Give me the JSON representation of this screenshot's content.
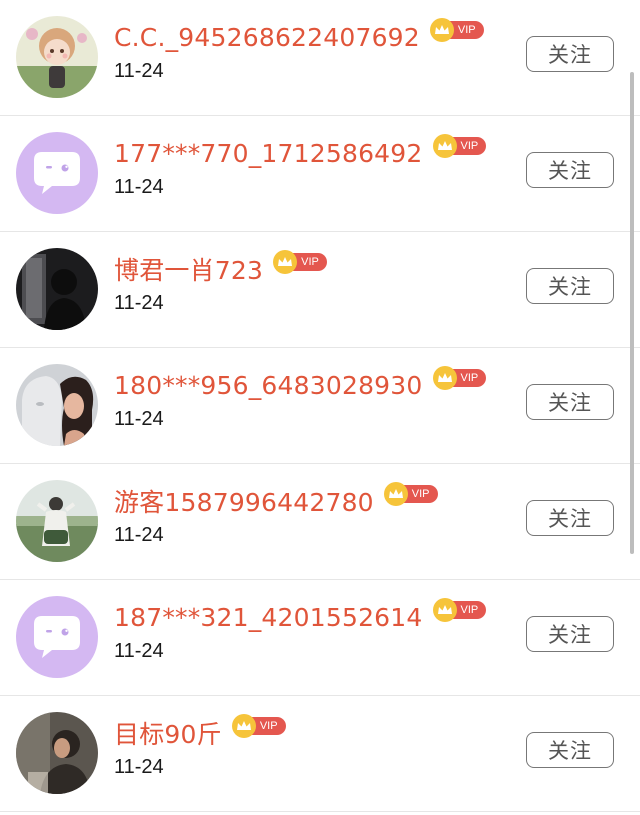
{
  "users": [
    {
      "name": "C.C._945268622407692",
      "vip_label": "VIP",
      "date": "11-24",
      "follow_label": "关注",
      "avatar": "girl-illustration-avatar"
    },
    {
      "name": "177***770_1712586492",
      "vip_label": "VIP",
      "date": "11-24",
      "follow_label": "关注",
      "avatar": "default-chat-bubble-avatar"
    },
    {
      "name": "博君一肖723",
      "vip_label": "VIP",
      "date": "11-24",
      "follow_label": "关注",
      "avatar": "dark-silhouette-avatar"
    },
    {
      "name": "180***956_6483028930",
      "vip_label": "VIP",
      "date": "11-24",
      "follow_label": "关注",
      "avatar": "statue-portrait-avatar"
    },
    {
      "name": "游客1587996442780",
      "vip_label": "VIP",
      "date": "11-24",
      "follow_label": "关注",
      "avatar": "field-photo-avatar"
    },
    {
      "name": "187***321_4201552614",
      "vip_label": "VIP",
      "date": "11-24",
      "follow_label": "关注",
      "avatar": "default-chat-bubble-avatar"
    },
    {
      "name": "目标90斤",
      "vip_label": "VIP",
      "date": "11-24",
      "follow_label": "关注",
      "avatar": "dim-portrait-avatar"
    }
  ],
  "colors": {
    "name": "#e0553a",
    "vip_tag": "#e4574f",
    "crown": "#f6c43a",
    "default_avatar_bg": "#d4b8f2",
    "follow_border": "#777777"
  }
}
